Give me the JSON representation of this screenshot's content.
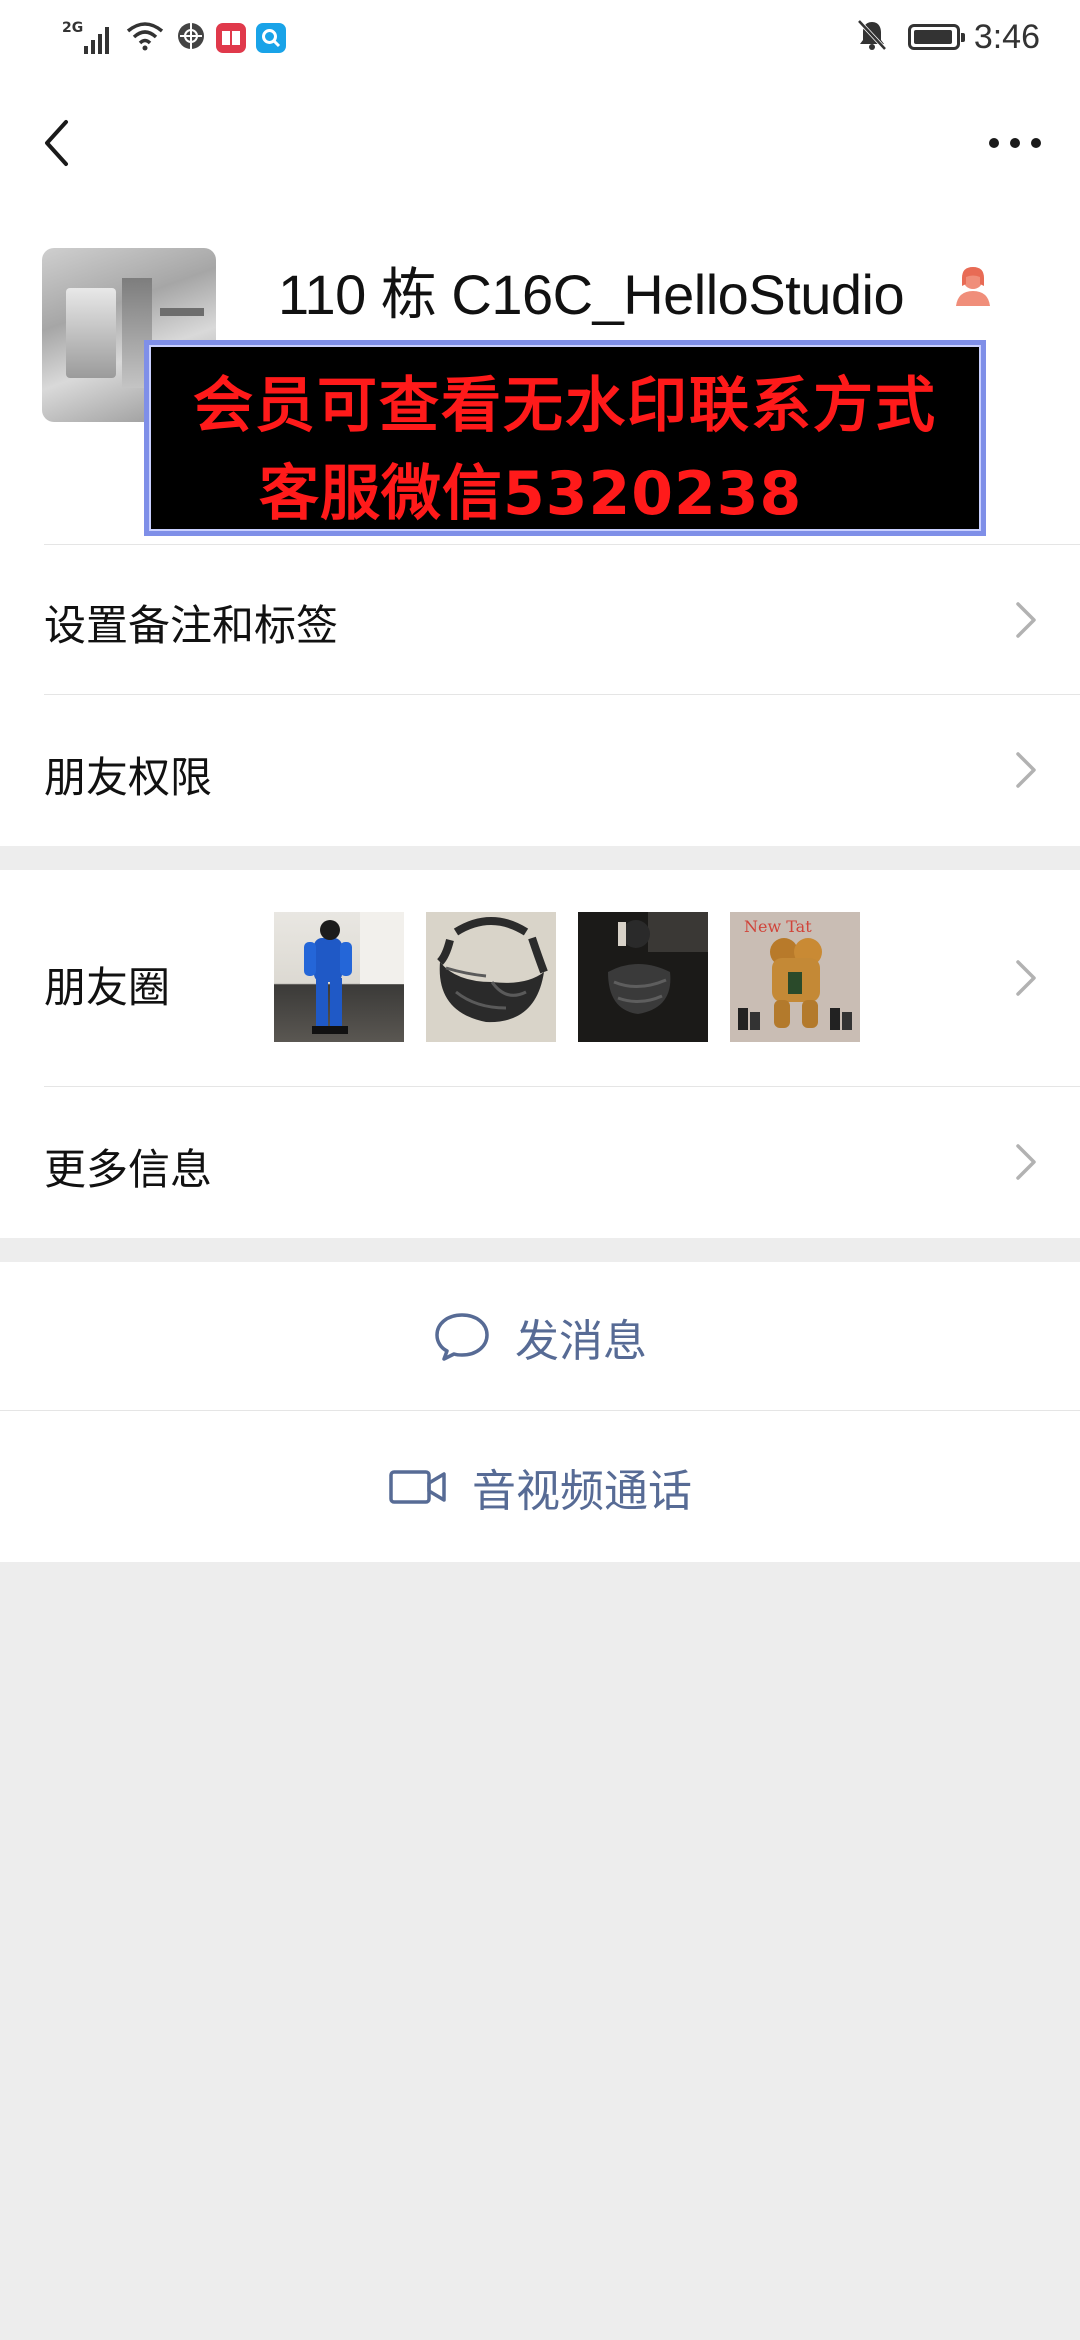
{
  "status_bar": {
    "network": "2G",
    "time": "3:46",
    "battery_level": 0.95,
    "icons": [
      "signal-icon",
      "wifi-icon",
      "vpn-icon",
      "book-app-icon",
      "search-app-icon",
      "mute-icon",
      "battery-icon"
    ]
  },
  "nav": {
    "back_icon": "chevron-left-icon",
    "more_icon": "more-dots-icon"
  },
  "profile": {
    "display_name": "110 栋 C16C_HelloStudio",
    "gender_icon": "female-icon",
    "watermark": {
      "line1": "会员可查看无水印联系方式",
      "line2": "客服微信5320238"
    }
  },
  "rows": {
    "remark_label": "设置备注和标签",
    "permissions_label": "朋友权限",
    "moments_label": "朋友圈",
    "more_info_label": "更多信息"
  },
  "actions": {
    "message_label": "发消息",
    "video_call_label": "音视频通话"
  },
  "colors": {
    "link_blue": "#576b95",
    "background": "#ededed",
    "watermark_red": "#ff1a1a"
  }
}
